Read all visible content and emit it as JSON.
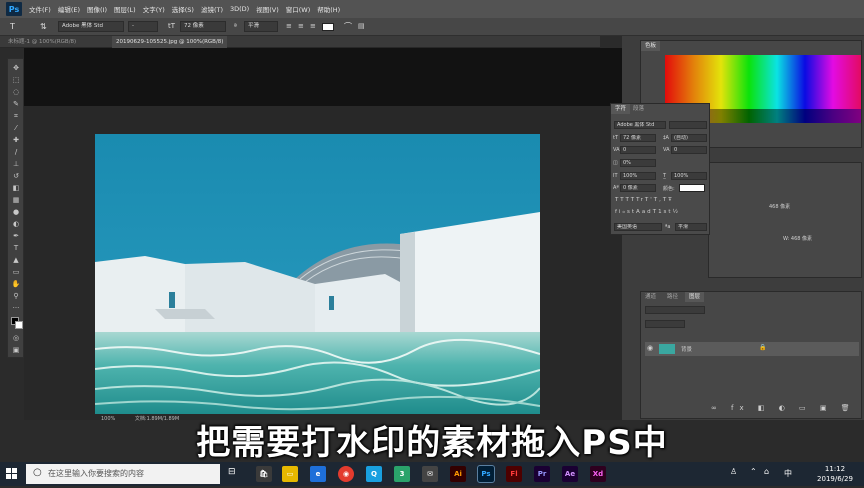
{
  "app": {
    "logo": "Ps",
    "menu": [
      "文件(F)",
      "编辑(E)",
      "图像(I)",
      "图层(L)",
      "文字(Y)",
      "选择(S)",
      "滤镜(T)",
      "3D(D)",
      "视图(V)",
      "窗口(W)",
      "帮助(H)"
    ]
  },
  "options_bar": {
    "tool_glyph": "T",
    "font_family": "Adobe 黑体 Std",
    "font_style": "-",
    "font_size": "72 像素",
    "anti_alias": "平滑"
  },
  "tabs": [
    {
      "label": "未标题-1 @ 100%(RGB/8)",
      "active": false
    },
    {
      "label": "20190629-105525.jpg @ 100%(RGB/8)",
      "active": true
    }
  ],
  "status": {
    "zoom": "100%",
    "doc": "文档:1.89M/1.89M"
  },
  "character_panel": {
    "tabs": [
      "字符",
      "段落"
    ],
    "font_family": "Adobe 黑体 Std",
    "font_size": "72 像素",
    "leading": "(自动)",
    "kerning": "0",
    "tracking": "0",
    "scale_percent": "0%",
    "vertical_scale": "100%",
    "horizontal_scale": "100%",
    "baseline": "0 像素",
    "color_label": "颜色:",
    "language": "美国英语",
    "aa": "平滑",
    "format_glyphs": [
      "T",
      "T",
      "TT",
      "Tr",
      "T'",
      "T,",
      "T",
      "Ŧ"
    ],
    "ot_glyphs": [
      "fi",
      "ℴ",
      "st",
      "A",
      "ad",
      "T",
      "1st",
      "½"
    ]
  },
  "layers_panel": {
    "tabs": [
      "通道",
      "路径",
      "图层"
    ],
    "layer_name": "背景"
  },
  "info_snippets": {
    "w": "468 像素",
    "hw": "W: 468 像素"
  },
  "subtitle": "把需要打水印的素材拖入PS中",
  "taskbar": {
    "search_placeholder": "在这里输入你要搜索的内容",
    "time": "11:12",
    "date": "2019/6/29",
    "ime": "中"
  },
  "colors": {
    "sky": "#1e8fb3",
    "water": "#3aa7a0",
    "building": "#e8eef0",
    "ps_blue": "#31a8ff",
    "accent_orange": "#ff7c00",
    "premiere": "#9999ff",
    "after_effects": "#d291ff",
    "xd": "#ff61f6",
    "acrobat": "#ff0000"
  }
}
